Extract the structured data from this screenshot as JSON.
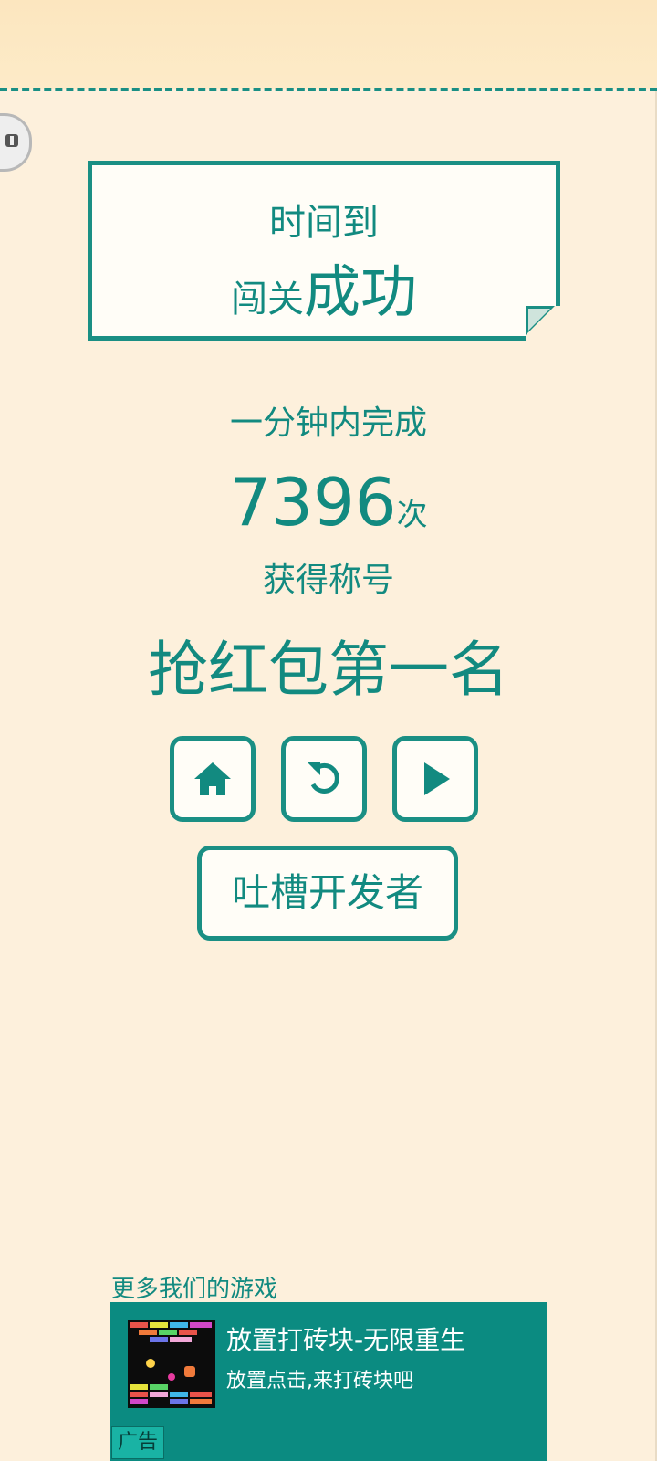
{
  "pause_icon": "pause-icon",
  "result_card": {
    "line1": "时间到",
    "line2_prefix": "闯关",
    "line2_emphasis": "成功"
  },
  "stats": {
    "intro": "一分钟内完成",
    "count": "7396",
    "count_unit": "次",
    "title_label": "获得称号",
    "title_value": "抢红包第一名"
  },
  "buttons": {
    "home_icon": "home-icon",
    "restart_icon": "restart-icon",
    "next_icon": "play-icon",
    "feedback_label": "吐槽开发者"
  },
  "more_games": {
    "heading": "更多我们的游戏",
    "ad": {
      "title": "放置打砖块-无限重生",
      "subtitle": "放置点击,来打砖块吧",
      "tag": "广告"
    }
  },
  "colors": {
    "accent": "#128a80",
    "background": "#fdf0dc",
    "ad_background": "#0b8b81"
  }
}
